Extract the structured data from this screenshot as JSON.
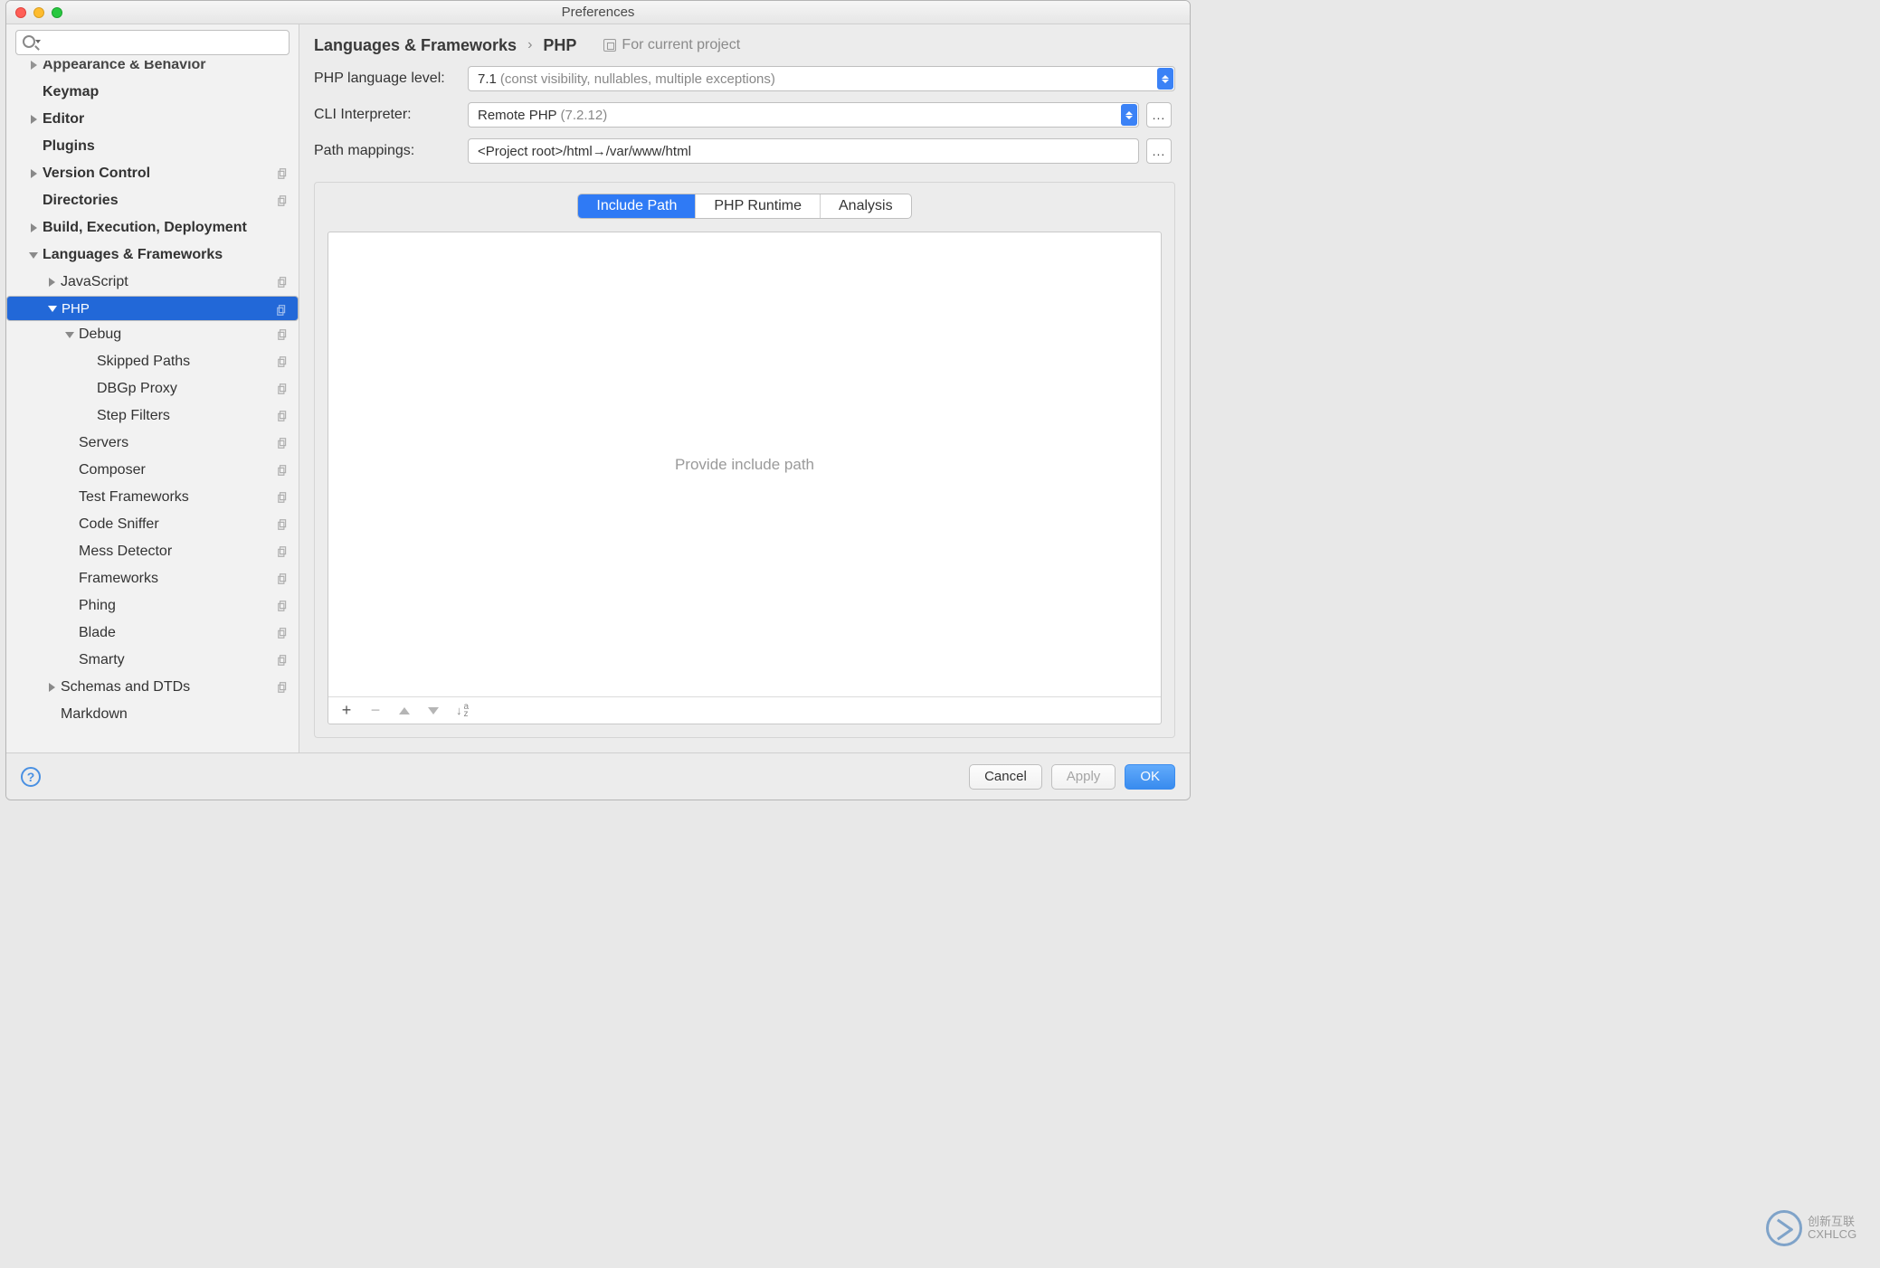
{
  "window": {
    "title": "Preferences"
  },
  "search": {
    "placeholder": ""
  },
  "sidebar": [
    {
      "label": "Appearance & Behavior",
      "indent": 0,
      "arrow": "r",
      "bold": true,
      "copy": false,
      "cut": true
    },
    {
      "label": "Keymap",
      "indent": 0,
      "arrow": "",
      "bold": true,
      "copy": false
    },
    {
      "label": "Editor",
      "indent": 0,
      "arrow": "r",
      "bold": true,
      "copy": false
    },
    {
      "label": "Plugins",
      "indent": 0,
      "arrow": "",
      "bold": true,
      "copy": false
    },
    {
      "label": "Version Control",
      "indent": 0,
      "arrow": "r",
      "bold": true,
      "copy": true
    },
    {
      "label": "Directories",
      "indent": 0,
      "arrow": "",
      "bold": true,
      "copy": true
    },
    {
      "label": "Build, Execution, Deployment",
      "indent": 0,
      "arrow": "r",
      "bold": true,
      "copy": false
    },
    {
      "label": "Languages & Frameworks",
      "indent": 0,
      "arrow": "d",
      "bold": true,
      "copy": false
    },
    {
      "label": "JavaScript",
      "indent": 1,
      "arrow": "r",
      "bold": false,
      "copy": true
    },
    {
      "label": "PHP",
      "indent": 1,
      "arrow": "d",
      "bold": false,
      "copy": true,
      "sel": true
    },
    {
      "label": "Debug",
      "indent": 2,
      "arrow": "d",
      "bold": false,
      "copy": true
    },
    {
      "label": "Skipped Paths",
      "indent": 3,
      "arrow": "",
      "bold": false,
      "copy": true
    },
    {
      "label": "DBGp Proxy",
      "indent": 3,
      "arrow": "",
      "bold": false,
      "copy": true
    },
    {
      "label": "Step Filters",
      "indent": 3,
      "arrow": "",
      "bold": false,
      "copy": true
    },
    {
      "label": "Servers",
      "indent": 2,
      "arrow": "",
      "bold": false,
      "copy": true
    },
    {
      "label": "Composer",
      "indent": 2,
      "arrow": "",
      "bold": false,
      "copy": true
    },
    {
      "label": "Test Frameworks",
      "indent": 2,
      "arrow": "",
      "bold": false,
      "copy": true
    },
    {
      "label": "Code Sniffer",
      "indent": 2,
      "arrow": "",
      "bold": false,
      "copy": true
    },
    {
      "label": "Mess Detector",
      "indent": 2,
      "arrow": "",
      "bold": false,
      "copy": true
    },
    {
      "label": "Frameworks",
      "indent": 2,
      "arrow": "",
      "bold": false,
      "copy": true
    },
    {
      "label": "Phing",
      "indent": 2,
      "arrow": "",
      "bold": false,
      "copy": true
    },
    {
      "label": "Blade",
      "indent": 2,
      "arrow": "",
      "bold": false,
      "copy": true
    },
    {
      "label": "Smarty",
      "indent": 2,
      "arrow": "",
      "bold": false,
      "copy": true
    },
    {
      "label": "Schemas and DTDs",
      "indent": 1,
      "arrow": "r",
      "bold": false,
      "copy": true
    },
    {
      "label": "Markdown",
      "indent": 1,
      "arrow": "",
      "bold": false,
      "copy": false
    }
  ],
  "breadcrumb": {
    "a": "Languages & Frameworks",
    "sep": "›",
    "b": "PHP",
    "proj": "For current project"
  },
  "form": {
    "lang_label": "PHP language level:",
    "lang_value": "7.1",
    "lang_hint": "(const visibility, nullables, multiple exceptions)",
    "cli_label": "CLI Interpreter:",
    "cli_value": "Remote PHP",
    "cli_hint": "(7.2.12)",
    "path_label": "Path mappings:",
    "path_value": "<Project root>/html→/var/www/html",
    "dots": "..."
  },
  "tabs": {
    "a": "Include Path",
    "b": "PHP Runtime",
    "c": "Analysis"
  },
  "panel": {
    "placeholder": "Provide include path",
    "sort": "a\nz"
  },
  "footer": {
    "help": "?",
    "cancel": "Cancel",
    "apply": "Apply",
    "ok": "OK"
  },
  "watermark": {
    "t1": "创新互联",
    "t2": "CXHLCG"
  }
}
